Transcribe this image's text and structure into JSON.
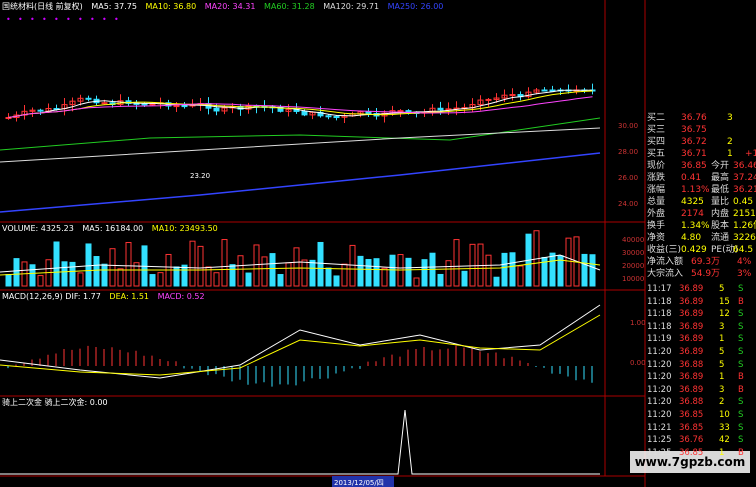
{
  "header": {
    "title": "国统材料(日线 前复权)",
    "ma5": "MA5: 37.75",
    "ma10": "MA10: 36.80",
    "ma20": "MA20: 34.31",
    "ma60": "MA60: 31.28",
    "ma120": "MA120: 29.71",
    "ma250": "MA250: 26.00"
  },
  "volume_header": {
    "volume": "VOLUME: 4325.23",
    "ma5": "MA5: 16184.00",
    "ma10": "MA10: 23493.50"
  },
  "macd_header": {
    "macd": "MACD(12,26,9)  DIF: 1.77",
    "dea": "DEA: 1.51",
    "macdv": "MACD: 0.52"
  },
  "ind_header": {
    "label": "骑上二次金  骑上二次金: 0.00"
  },
  "price_axis": [
    "30.00",
    "28.00",
    "26.00",
    "24.00"
  ],
  "vol_axis": [
    "40000",
    "30000",
    "20000",
    "10000"
  ],
  "macd_axis": [
    "1.00",
    "0.00"
  ],
  "annotations": {
    "low": "23.20"
  },
  "bottom_axis": {
    "date_label": "2013/12/05/四"
  },
  "quote": {
    "bids": [
      {
        "label": "买二",
        "price": "36.76",
        "vol": "3",
        "chg": ""
      },
      {
        "label": "买三",
        "price": "36.75",
        "vol": "",
        "chg": ""
      },
      {
        "label": "买四",
        "price": "36.72",
        "vol": "2",
        "chg": ""
      },
      {
        "label": "买五",
        "price": "36.71",
        "vol": "1",
        "chg": "+1"
      }
    ],
    "rows": [
      {
        "l1": "现价",
        "v1": "36.85",
        "l2": "今开",
        "v2": "36.46"
      },
      {
        "l1": "涨跌",
        "v1": "0.41",
        "l2": "最高",
        "v2": "37.24"
      },
      {
        "l1": "涨幅",
        "v1": "1.13%",
        "l2": "最低",
        "v2": "36.21"
      },
      {
        "l1": "总量",
        "v1": "4325",
        "l2": "量比",
        "v2": "0.45"
      },
      {
        "l1": "外盘",
        "v1": "2174",
        "l2": "内盘",
        "v2": "2151"
      },
      {
        "l1": "换手",
        "v1": "1.34%",
        "l2": "股本",
        "v2": "1.26亿"
      },
      {
        "l1": "净资",
        "v1": "4.80",
        "l2": "流通",
        "v2": "3226万"
      },
      {
        "l1": "收益(三)",
        "v1": "0.429",
        "l2": "PE(动)",
        "v2": "64.5"
      }
    ],
    "flows": [
      {
        "label": "净流入额",
        "val": "69.3万",
        "pct": "4%"
      },
      {
        "label": "大宗流入",
        "val": "54.9万",
        "pct": "3%"
      }
    ]
  },
  "ticks": [
    {
      "time": "11:17",
      "price": "36.89",
      "vol": "5",
      "side": "S"
    },
    {
      "time": "11:18",
      "price": "36.89",
      "vol": "15",
      "side": "B"
    },
    {
      "time": "11:18",
      "price": "36.89",
      "vol": "12",
      "side": "S"
    },
    {
      "time": "11:18",
      "price": "36.89",
      "vol": "3",
      "side": "S"
    },
    {
      "time": "11:19",
      "price": "36.89",
      "vol": "1",
      "side": "S"
    },
    {
      "time": "11:20",
      "price": "36.89",
      "vol": "5",
      "side": "S"
    },
    {
      "time": "11:20",
      "price": "36.88",
      "vol": "5",
      "side": "S"
    },
    {
      "time": "11:20",
      "price": "36.89",
      "vol": "1",
      "side": "B"
    },
    {
      "time": "11:20",
      "price": "36.89",
      "vol": "3",
      "side": "B"
    },
    {
      "time": "11:20",
      "price": "36.88",
      "vol": "2",
      "side": "S"
    },
    {
      "time": "11:20",
      "price": "36.85",
      "vol": "10",
      "side": "S"
    },
    {
      "time": "11:21",
      "price": "36.85",
      "vol": "33",
      "side": "S"
    },
    {
      "time": "11:25",
      "price": "36.76",
      "vol": "42",
      "side": "S"
    },
    {
      "time": "11:25",
      "price": "36.85",
      "vol": "1",
      "side": "B"
    }
  ],
  "watermark": "www.7gpzb.com",
  "colors": {
    "up": "#ff3333",
    "down": "#33e0ff",
    "ma5": "#ffffff",
    "ma10": "#ffff00",
    "ma20": "#ff44ff",
    "ma60": "#22cc22",
    "ma120": "#dddddd",
    "ma250": "#3344ff"
  }
}
